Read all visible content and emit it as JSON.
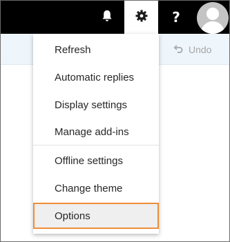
{
  "topbar": {
    "icons": [
      "bell-icon",
      "gear-icon",
      "help-icon",
      "avatar-icon"
    ],
    "help_label": "?",
    "accent": "#000000"
  },
  "toolbar": {
    "undo_label": "Undo",
    "undo_icon": "undo-icon"
  },
  "settings_menu": {
    "items": [
      {
        "label": "Refresh"
      },
      {
        "label": "Automatic replies"
      },
      {
        "label": "Display settings"
      },
      {
        "label": "Manage add-ins"
      },
      {
        "label": "Offline settings"
      },
      {
        "label": "Change theme"
      },
      {
        "label": "Options",
        "highlighted": true
      }
    ],
    "highlight_color": "#f08c36"
  }
}
